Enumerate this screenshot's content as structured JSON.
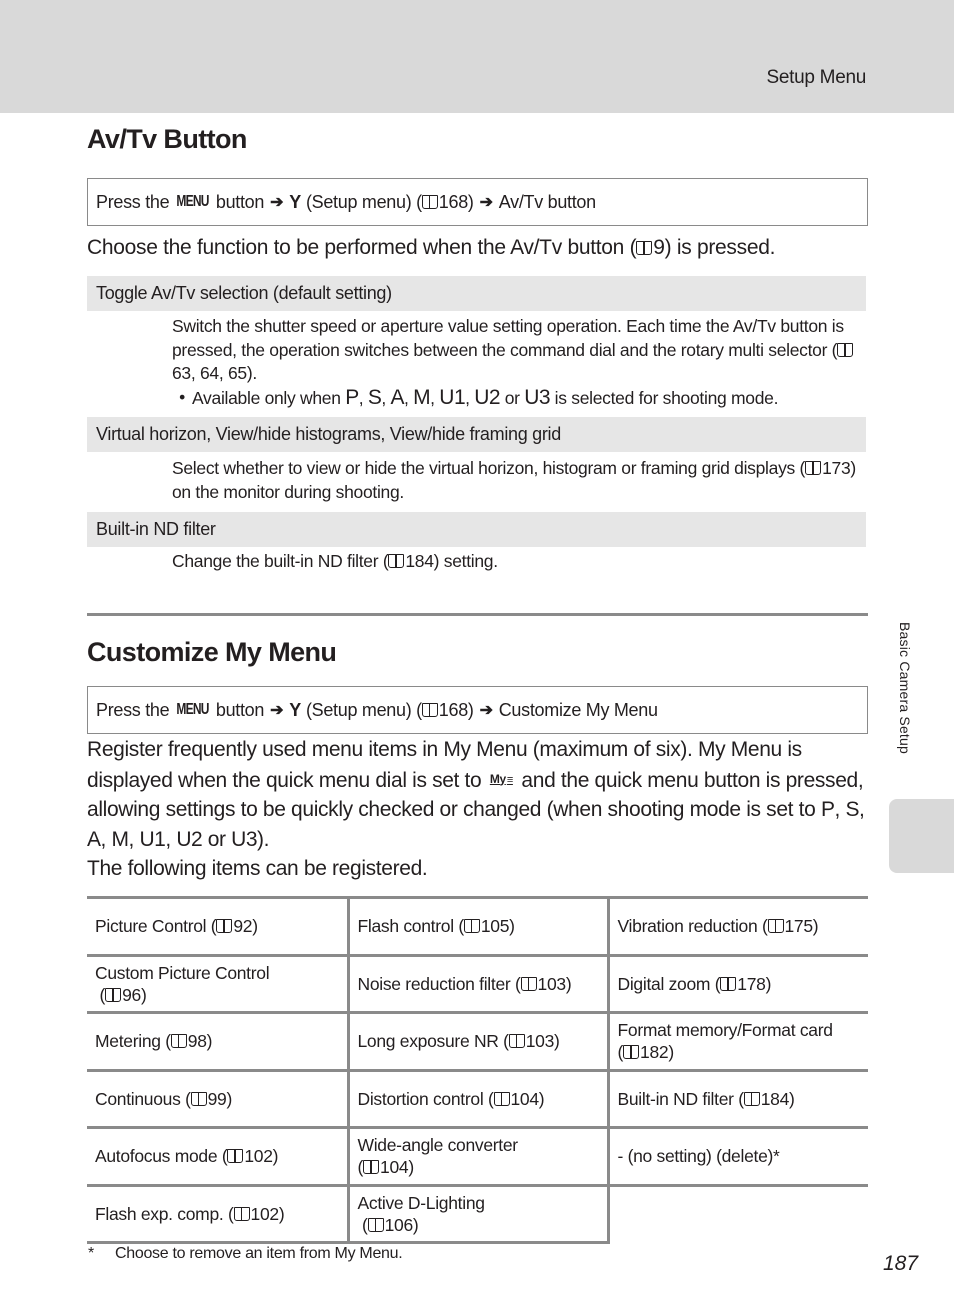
{
  "running_head": "Setup Menu",
  "side_tab_label": "Basic Camera Setup",
  "page_number": "187",
  "section_avtv": {
    "title": "Av/Tv Button",
    "nav": {
      "prefix": "Press the",
      "menu_glyph": "MENU",
      "button_word": "button",
      "arrow": "➔",
      "wrench": "Y",
      "setup_text": "(Setup menu) (",
      "ref": "168)",
      "target": "Av/Tv button"
    },
    "intro_pre": "Choose the function to be performed when the Av/Tv button (",
    "intro_ref": "9) is pressed.",
    "options": [
      {
        "heading": "Toggle Av/Tv selection (default setting)",
        "body_pre": "Switch the shutter speed or aperture value setting operation. Each time the Av/Tv button is pressed, the operation switches between the command dial and the rotary multi selector (",
        "body_ref": "63, 64, 65).",
        "bullet_pre": "Available only when",
        "modes": [
          "P",
          "S",
          "A",
          "M",
          "U1",
          "U2"
        ],
        "modes_or": "or",
        "mode_last": "U3",
        "bullet_post": "is selected for shooting mode."
      },
      {
        "heading": "Virtual horizon, View/hide histograms, View/hide framing grid",
        "body_pre": "Select whether to view or hide the virtual horizon, histogram or framing grid displays (",
        "body_ref": "173) on the monitor during shooting."
      },
      {
        "heading": "Built-in ND filter",
        "body_pre": "Change the built-in ND filter (",
        "body_ref": "184) setting."
      }
    ]
  },
  "section_mymenu": {
    "title": "Customize My Menu",
    "nav": {
      "prefix": "Press the",
      "menu_glyph": "MENU",
      "button_word": "button",
      "arrow": "➔",
      "wrench": "Y",
      "setup_text": "(Setup menu) (",
      "ref": "168)",
      "target": "Customize My Menu"
    },
    "para_1": "Register frequently used menu items in My Menu (maximum of six). My Menu is displayed when the quick menu dial is set to",
    "my_icon": "My",
    "para_2": "and the quick menu button is pressed, allowing settings to be quickly checked or changed (when shooting mode is set to",
    "modes": [
      "P",
      "S",
      "A",
      "M",
      "U1",
      "U2"
    ],
    "modes_or": "or",
    "mode_last": "U3",
    "para_3": ").",
    "para_4": "The following items can be registered.",
    "table": [
      [
        {
          "label": "Picture Control (",
          "ref": "92)"
        },
        {
          "label": "Flash control (",
          "ref": "105)"
        },
        {
          "label": "Vibration reduction (",
          "ref": "175)"
        }
      ],
      [
        {
          "label": "Custom Picture Control",
          "ref_line": " (",
          "ref": "96)"
        },
        {
          "label": "Noise reduction filter (",
          "ref": "103)"
        },
        {
          "label": "Digital zoom (",
          "ref": "178)"
        }
      ],
      [
        {
          "label": "Metering (",
          "ref": "98)"
        },
        {
          "label": "Long exposure NR (",
          "ref": "103)"
        },
        {
          "label": "Format memory/Format card",
          "ref_line": "(",
          "ref": "182)"
        }
      ],
      [
        {
          "label": "Continuous (",
          "ref": "99)"
        },
        {
          "label": "Distortion control (",
          "ref": "104)"
        },
        {
          "label": "Built-in ND filter (",
          "ref": "184)"
        }
      ],
      [
        {
          "label": "Autofocus mode (",
          "ref": "102)"
        },
        {
          "label": "Wide-angle converter",
          "ref_line": "(",
          "ref": "104)"
        },
        {
          "label": "- (no setting) (delete)*"
        }
      ],
      [
        {
          "label": "Flash exp. comp. (",
          "ref": "102)"
        },
        {
          "label": "Active D-Lighting",
          "ref_line": " (",
          "ref": "106)"
        },
        null
      ]
    ],
    "footnote_mark": "*",
    "footnote": "Choose to remove an item from My Menu."
  }
}
